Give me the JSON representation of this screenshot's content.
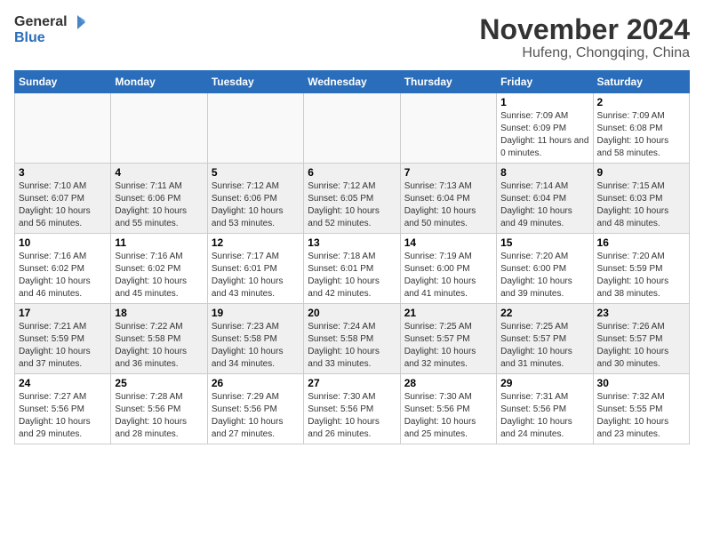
{
  "header": {
    "logo_general": "General",
    "logo_blue": "Blue",
    "month_title": "November 2024",
    "subtitle": "Hufeng, Chongqing, China"
  },
  "weekdays": [
    "Sunday",
    "Monday",
    "Tuesday",
    "Wednesday",
    "Thursday",
    "Friday",
    "Saturday"
  ],
  "weeks": [
    [
      {
        "day": "",
        "empty": true
      },
      {
        "day": "",
        "empty": true
      },
      {
        "day": "",
        "empty": true
      },
      {
        "day": "",
        "empty": true
      },
      {
        "day": "",
        "empty": true
      },
      {
        "day": "1",
        "sunrise": "7:09 AM",
        "sunset": "6:09 PM",
        "daylight": "11 hours and 0 minutes."
      },
      {
        "day": "2",
        "sunrise": "7:09 AM",
        "sunset": "6:08 PM",
        "daylight": "10 hours and 58 minutes."
      }
    ],
    [
      {
        "day": "3",
        "sunrise": "7:10 AM",
        "sunset": "6:07 PM",
        "daylight": "10 hours and 56 minutes."
      },
      {
        "day": "4",
        "sunrise": "7:11 AM",
        "sunset": "6:06 PM",
        "daylight": "10 hours and 55 minutes."
      },
      {
        "day": "5",
        "sunrise": "7:12 AM",
        "sunset": "6:06 PM",
        "daylight": "10 hours and 53 minutes."
      },
      {
        "day": "6",
        "sunrise": "7:12 AM",
        "sunset": "6:05 PM",
        "daylight": "10 hours and 52 minutes."
      },
      {
        "day": "7",
        "sunrise": "7:13 AM",
        "sunset": "6:04 PM",
        "daylight": "10 hours and 50 minutes."
      },
      {
        "day": "8",
        "sunrise": "7:14 AM",
        "sunset": "6:04 PM",
        "daylight": "10 hours and 49 minutes."
      },
      {
        "day": "9",
        "sunrise": "7:15 AM",
        "sunset": "6:03 PM",
        "daylight": "10 hours and 48 minutes."
      }
    ],
    [
      {
        "day": "10",
        "sunrise": "7:16 AM",
        "sunset": "6:02 PM",
        "daylight": "10 hours and 46 minutes."
      },
      {
        "day": "11",
        "sunrise": "7:16 AM",
        "sunset": "6:02 PM",
        "daylight": "10 hours and 45 minutes."
      },
      {
        "day": "12",
        "sunrise": "7:17 AM",
        "sunset": "6:01 PM",
        "daylight": "10 hours and 43 minutes."
      },
      {
        "day": "13",
        "sunrise": "7:18 AM",
        "sunset": "6:01 PM",
        "daylight": "10 hours and 42 minutes."
      },
      {
        "day": "14",
        "sunrise": "7:19 AM",
        "sunset": "6:00 PM",
        "daylight": "10 hours and 41 minutes."
      },
      {
        "day": "15",
        "sunrise": "7:20 AM",
        "sunset": "6:00 PM",
        "daylight": "10 hours and 39 minutes."
      },
      {
        "day": "16",
        "sunrise": "7:20 AM",
        "sunset": "5:59 PM",
        "daylight": "10 hours and 38 minutes."
      }
    ],
    [
      {
        "day": "17",
        "sunrise": "7:21 AM",
        "sunset": "5:59 PM",
        "daylight": "10 hours and 37 minutes."
      },
      {
        "day": "18",
        "sunrise": "7:22 AM",
        "sunset": "5:58 PM",
        "daylight": "10 hours and 36 minutes."
      },
      {
        "day": "19",
        "sunrise": "7:23 AM",
        "sunset": "5:58 PM",
        "daylight": "10 hours and 34 minutes."
      },
      {
        "day": "20",
        "sunrise": "7:24 AM",
        "sunset": "5:58 PM",
        "daylight": "10 hours and 33 minutes."
      },
      {
        "day": "21",
        "sunrise": "7:25 AM",
        "sunset": "5:57 PM",
        "daylight": "10 hours and 32 minutes."
      },
      {
        "day": "22",
        "sunrise": "7:25 AM",
        "sunset": "5:57 PM",
        "daylight": "10 hours and 31 minutes."
      },
      {
        "day": "23",
        "sunrise": "7:26 AM",
        "sunset": "5:57 PM",
        "daylight": "10 hours and 30 minutes."
      }
    ],
    [
      {
        "day": "24",
        "sunrise": "7:27 AM",
        "sunset": "5:56 PM",
        "daylight": "10 hours and 29 minutes."
      },
      {
        "day": "25",
        "sunrise": "7:28 AM",
        "sunset": "5:56 PM",
        "daylight": "10 hours and 28 minutes."
      },
      {
        "day": "26",
        "sunrise": "7:29 AM",
        "sunset": "5:56 PM",
        "daylight": "10 hours and 27 minutes."
      },
      {
        "day": "27",
        "sunrise": "7:30 AM",
        "sunset": "5:56 PM",
        "daylight": "10 hours and 26 minutes."
      },
      {
        "day": "28",
        "sunrise": "7:30 AM",
        "sunset": "5:56 PM",
        "daylight": "10 hours and 25 minutes."
      },
      {
        "day": "29",
        "sunrise": "7:31 AM",
        "sunset": "5:56 PM",
        "daylight": "10 hours and 24 minutes."
      },
      {
        "day": "30",
        "sunrise": "7:32 AM",
        "sunset": "5:55 PM",
        "daylight": "10 hours and 23 minutes."
      }
    ]
  ]
}
